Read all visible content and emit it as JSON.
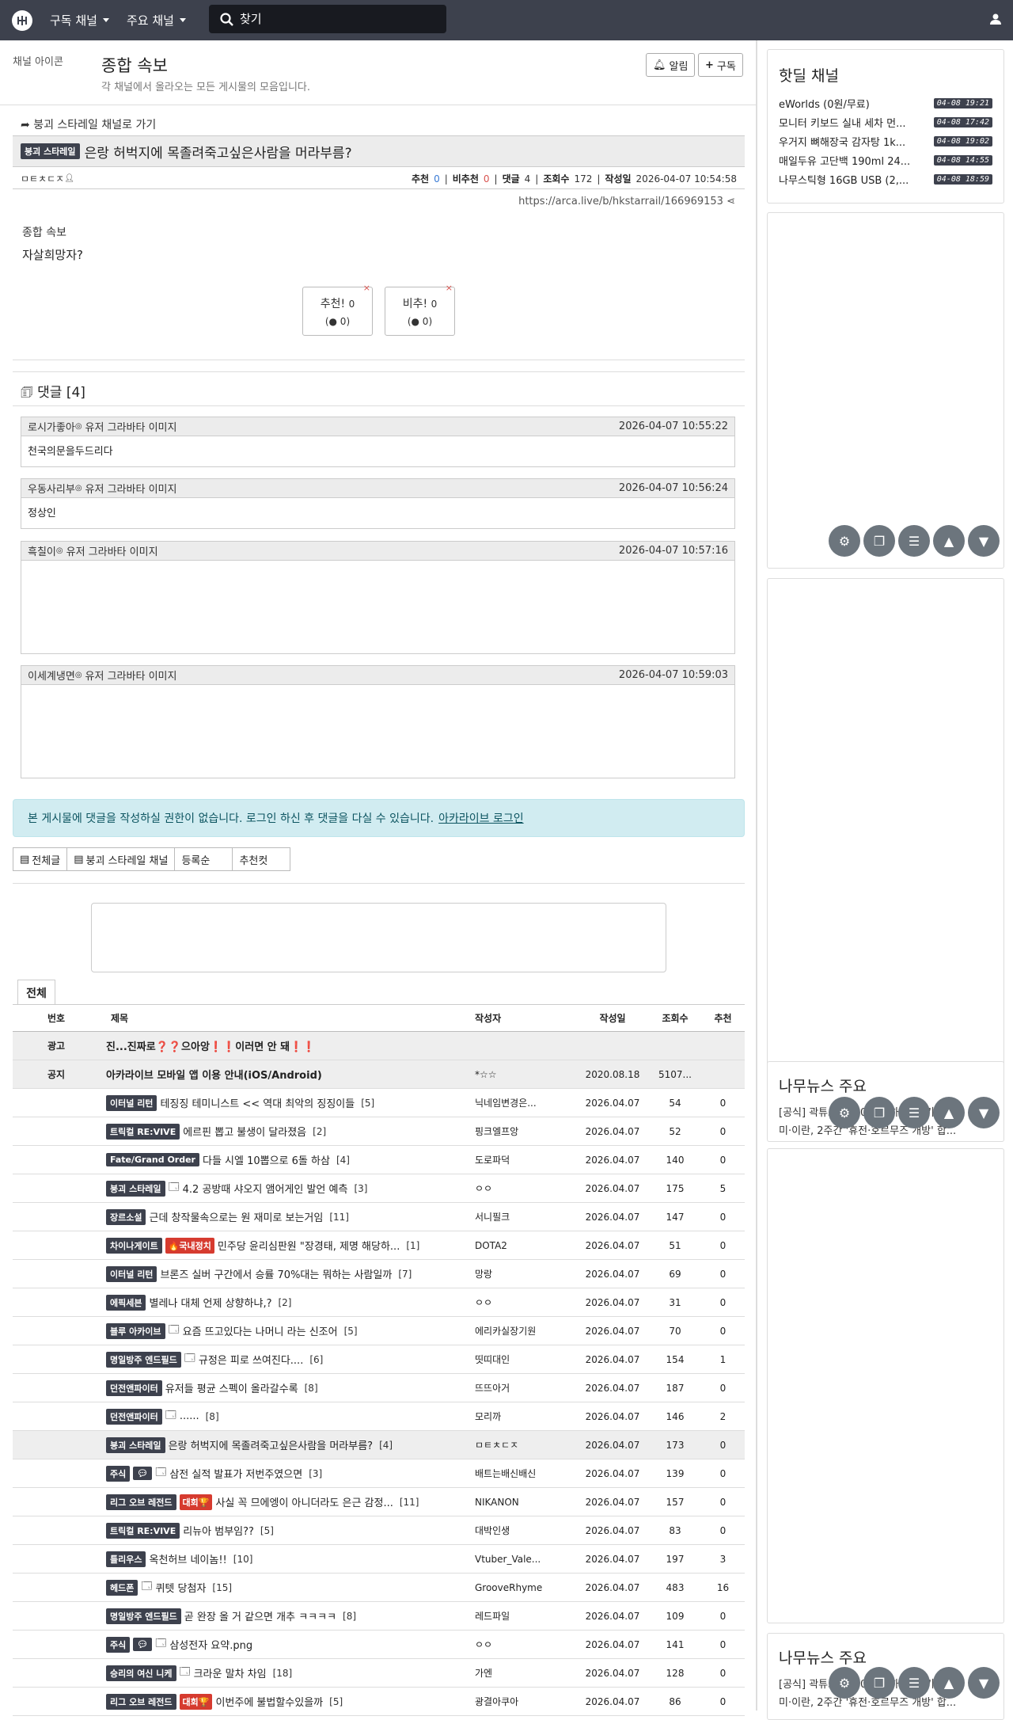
{
  "nav": {
    "logo": "",
    "menu1": "구독 채널",
    "menu2": "주요 채널",
    "search_placeholder": "찾기"
  },
  "board": {
    "icon_alt": "채널 아이콘",
    "title": "종합 속보",
    "desc": "각 채널에서 올라오는 모든 게시물의 모음입니다.",
    "alarm": "알림",
    "subscribe": "구독"
  },
  "post": {
    "back": "붕괴 스타레일 채널로 가기",
    "category": "붕괴 스타레일",
    "title": "은랑 허벅지에 목졸려죽고싶은사람을 머라부름?",
    "author": "ㅁㅌㅊㄷㅈ",
    "rec_label": "추천",
    "rec": "0",
    "nrec_label": "비추천",
    "nrec": "0",
    "cmt_label": "댓글",
    "cmt": "4",
    "view_label": "조회수",
    "view": "172",
    "date_label": "작성일",
    "date": "2026-04-07 10:54:58",
    "url": "https://arca.live/b/hkstarrail/166969153",
    "img_alt": "종합 속보",
    "text": "자살희망자?",
    "vote_up": "추천!",
    "vote_up_n": "0",
    "vote_up_sub": "(● 0)",
    "vote_down": "비추!",
    "vote_down_n": "0",
    "vote_down_sub": "(● 0)"
  },
  "comments": {
    "header": "댓글 [4]",
    "items": [
      {
        "user": "로시가좋아",
        "img": "유저 그라바타 이미지",
        "date": "2026-04-07 10:55:22",
        "text": "천국의문을두드리다"
      },
      {
        "user": "우동사리부",
        "img": "유저 그라바타 이미지",
        "date": "2026-04-07 10:56:24",
        "text": "정상인"
      },
      {
        "user": "흑칠이",
        "img": "유저 그라바타 이미지",
        "date": "2026-04-07 10:57:16",
        "text": ""
      },
      {
        "user": "이세계냉면",
        "img": "유저 그라바타 이미지",
        "date": "2026-04-07 10:59:03",
        "text": ""
      }
    ]
  },
  "alert": {
    "text": "본 게시물에 댓글을 작성하실 권한이 없습니다. 로그인 하신 후 댓글을 다실 수 있습니다.",
    "link": "아카라이브 로그인"
  },
  "filters": [
    "전체글",
    "붕괴 스타레일 채널",
    "등록순",
    "추천컷"
  ],
  "list_tab": "전체",
  "cols": [
    "번호",
    "제목",
    "작성자",
    "작성일",
    "조회수",
    "추천"
  ],
  "rows": [
    {
      "no": "광고",
      "title": "진...진짜로❓❓으아앙❗❗이러면 안 돼❗❗",
      "gray": true,
      "bold": true
    },
    {
      "no": "공지",
      "title": "아카라이브 모바일 앱 이용 안내(iOS/Android)",
      "author": "*☆☆",
      "date": "2020.08.18",
      "views": "5107...",
      "gray": true,
      "bold": true
    },
    {
      "cat": "이터널 리턴",
      "title": "테징징 테미니스트 << 역대 최악의 징징이들",
      "cnt": "[5]",
      "author": "닉네임변경은...",
      "date": "2026.04.07",
      "views": "54",
      "rec": "0"
    },
    {
      "cat": "트릭컬 RE:VIVE",
      "title": "에르핀 뽑고 불생이 달라졌음",
      "cnt": "[2]",
      "author": "핑크엘프앙",
      "date": "2026.04.07",
      "views": "52",
      "rec": "0"
    },
    {
      "cat": "Fate/Grand Order",
      "title": "다들 시엘 10뽑으로 6돌 하삼",
      "cnt": "[4]",
      "author": "도로파덕",
      "date": "2026.04.07",
      "views": "140",
      "rec": "0"
    },
    {
      "cat": "붕괴 스타레일",
      "title": "4.2 공방때 샤오지 앰어게인 발언 예측",
      "cnt": "[3]",
      "author": "ㅇㅇ",
      "date": "2026.04.07",
      "views": "175",
      "rec": "5",
      "img": true
    },
    {
      "cat": "장르소설",
      "title": "근데 창작물속으로는 원 재미로 보는거임",
      "cnt": "[11]",
      "author": "서니필크",
      "date": "2026.04.07",
      "views": "147",
      "rec": "0"
    },
    {
      "cat": "차이나게이트",
      "sub": "🔥국내정치",
      "title": "민주당 윤리심판원 \"장경태, 제명 해당하...",
      "cnt": "[1]",
      "author": "DOTA2",
      "date": "2026.04.07",
      "views": "51",
      "rec": "0"
    },
    {
      "cat": "이터널 리턴",
      "title": "브론즈 실버 구간에서 승률 70%대는 뭐하는 사람일까",
      "cnt": "[7]",
      "author": "망랑",
      "date": "2026.04.07",
      "views": "69",
      "rec": "0"
    },
    {
      "cat": "에픽세븐",
      "title": "별레나 대체 언제 상향하냐,?",
      "cnt": "[2]",
      "author": "ㅇㅇ",
      "date": "2026.04.07",
      "views": "31",
      "rec": "0"
    },
    {
      "cat": "블루 아카이브",
      "title": "요즘 뜨고있다는 나머니 라는 신조어",
      "cnt": "[5]",
      "author": "에리카실장기원",
      "date": "2026.04.07",
      "views": "70",
      "rec": "0",
      "img": true
    },
    {
      "cat": "명일방주 엔드필드",
      "title": "규정은 피로 쓰여진다....",
      "cnt": "[6]",
      "author": "띳띠대인",
      "date": "2026.04.07",
      "views": "154",
      "rec": "1",
      "img": true
    },
    {
      "cat": "던전앤파이터",
      "title": "유저들 평균 스펙이 올라갈수록",
      "cnt": "[8]",
      "author": "뜨뜨아거",
      "date": "2026.04.07",
      "views": "187",
      "rec": "0"
    },
    {
      "cat": "던전앤파이터",
      "title": "......",
      "cnt": "[8]",
      "author": "모리까",
      "date": "2026.04.07",
      "views": "146",
      "rec": "2",
      "img": true
    },
    {
      "cat": "붕괴 스타레일",
      "title": "은랑 허벅지에 목졸려죽고싶은사람을 머라부름?",
      "cnt": "[4]",
      "author": "ㅁㅌㅊㄷㅈ",
      "date": "2026.04.07",
      "views": "173",
      "rec": "0",
      "gray": true
    },
    {
      "cat": "주식",
      "title": "삼전 실적 발표가 저번주였으면",
      "cnt": "[3]",
      "author": "배트는배신배신",
      "date": "2026.04.07",
      "views": "139",
      "rec": "0",
      "img": true,
      "bubble": true
    },
    {
      "cat": "리그 오브 레전드",
      "sub": "대회🏆",
      "title": "사실 꼭 므에엥이 아니더라도 은근 감정...",
      "cnt": "[11]",
      "author": "NIKANON",
      "date": "2026.04.07",
      "views": "157",
      "rec": "0"
    },
    {
      "cat": "트릭컬 RE:VIVE",
      "title": "리뉴아 범부임??",
      "cnt": "[5]",
      "author": "대박인생",
      "date": "2026.04.07",
      "views": "83",
      "rec": "0"
    },
    {
      "cat": "틀리우스",
      "title": "옥천허브 네이놈!!",
      "cnt": "[10]",
      "author": "Vtuber_Vale...",
      "date": "2026.04.07",
      "views": "197",
      "rec": "3"
    },
    {
      "cat": "헤드폰",
      "title": "퀴텟 당첨자",
      "cnt": "[15]",
      "author": "GrooveRhyme",
      "date": "2026.04.07",
      "views": "483",
      "rec": "16",
      "img": true
    },
    {
      "cat": "명일방주 엔드필드",
      "title": "곧 완장 올 거 같으면 개추 ㅋㅋㅋㅋ",
      "cnt": "[8]",
      "author": "레드파일",
      "date": "2026.04.07",
      "views": "109",
      "rec": "0"
    },
    {
      "cat": "주식",
      "title": "삼성전자 요약.png",
      "cnt": "",
      "author": "ㅇㅇ",
      "date": "2026.04.07",
      "views": "141",
      "rec": "0",
      "img": true,
      "bubble": true
    },
    {
      "cat": "승리의 여신 니케",
      "title": "크라운 말차 차임",
      "cnt": "[18]",
      "author": "가엔",
      "date": "2026.04.07",
      "views": "128",
      "rec": "0",
      "img": true
    },
    {
      "cat": "리그 오브 레전드",
      "sub": "대회🏆",
      "title": "이번주에 불법할수있을까",
      "cnt": "[5]",
      "author": "광결아쿠아",
      "date": "2026.04.07",
      "views": "86",
      "rec": "0"
    }
  ],
  "hot": {
    "title": "핫딜 채널",
    "items": [
      {
        "t": "eWorlds (0원/무료)",
        "d": "04-08 19:21"
      },
      {
        "t": "모니터 키보드 실내 세차 먼...",
        "d": "04-08 17:42"
      },
      {
        "t": "우거지 뼈해장국 감자탕 1k...",
        "d": "04-08 19:02"
      },
      {
        "t": "매일두유 고단백 190ml 24...",
        "d": "04-08 14:55"
      },
      {
        "t": "나무스틱형 16GB USB (2,...",
        "d": "04-08 18:59"
      }
    ]
  },
  "news": {
    "title": "나무뉴스 주요",
    "line1": "[공식] 곽튜브 2500원 ...하고 [조기] 합...",
    "line2": "미·이란, 2주간 '휴전·호르무즈 개방' 합..."
  },
  "colors": {
    "nav": "#3d414d",
    "alert_bg": "#d1ecf1"
  }
}
